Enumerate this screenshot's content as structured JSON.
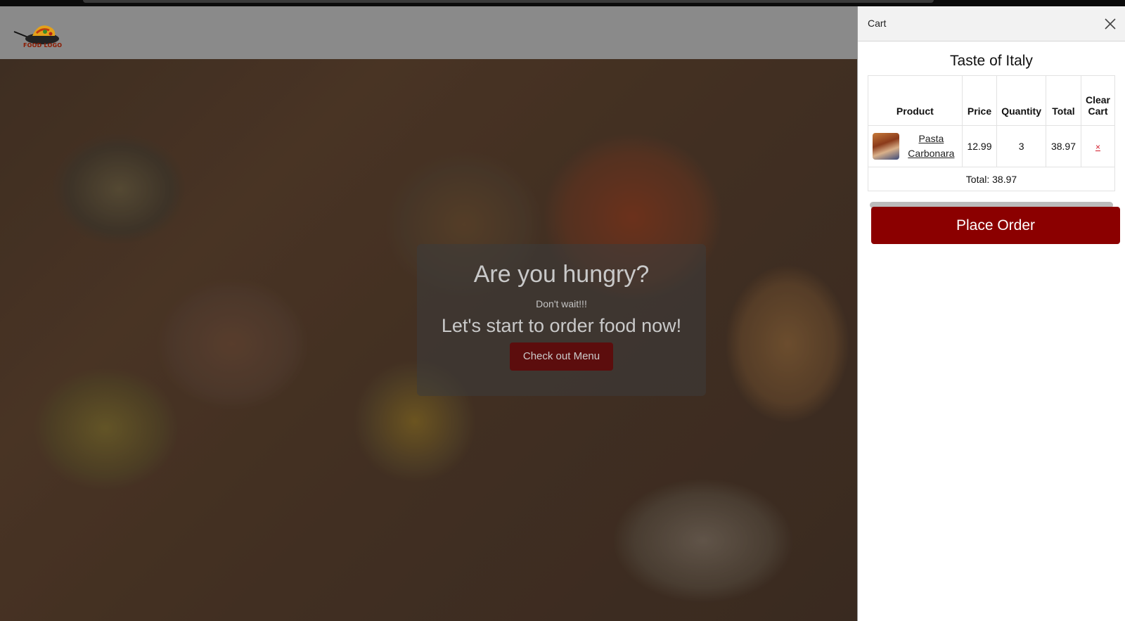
{
  "logo": {
    "text": "FOOD LOGO"
  },
  "hero": {
    "title": "Are you hungry?",
    "subtitle": "Don't wait!!!",
    "tagline": "Let's start to order food now!",
    "cta_label": "Check out Menu"
  },
  "cart": {
    "title": "Cart",
    "restaurant": "Taste of Italy",
    "columns": [
      "Product",
      "Price",
      "Quantity",
      "Total",
      "Clear Cart"
    ],
    "items": [
      {
        "name": "Pasta Carbonara",
        "price": "12.99",
        "quantity": "3",
        "total": "38.97",
        "remove_label": "×",
        "thumbnail": "pasta-carbonara-thumbnail"
      }
    ],
    "total_text": "Total: 38.97",
    "place_order_label": "Place Order"
  },
  "colors": {
    "accent": "#8b0000",
    "remove_link": "#d21b2a",
    "hero_button": "#5c0d0d"
  }
}
